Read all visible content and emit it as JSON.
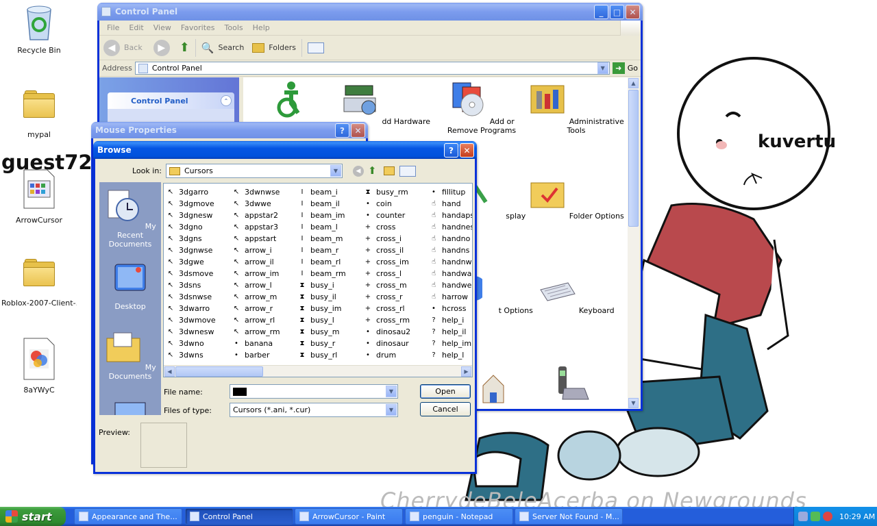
{
  "desktop": {
    "icons": [
      {
        "label": "Recycle Bin"
      },
      {
        "label": "mypal"
      },
      {
        "label": "ArrowCursor"
      },
      {
        "label": "Roblox-2007-Client-..."
      },
      {
        "label": "8aYWyC"
      }
    ],
    "overlay_text_left": "guest72",
    "overlay_text_right": "kuvertu",
    "watermark": "CherrydeBeleAcerba on Newgrounds"
  },
  "control_panel": {
    "title": "Control Panel",
    "menu": [
      "File",
      "Edit",
      "View",
      "Favorites",
      "Tools",
      "Help"
    ],
    "toolbar": {
      "back": "Back",
      "search": "Search",
      "folders": "Folders"
    },
    "address_label": "Address",
    "address_value": "Control Panel",
    "go_label": "Go",
    "task_pane_title": "Control Panel",
    "items": [
      {
        "label": "",
        "icon": "accessibility-icon"
      },
      {
        "label": "dd Hardware",
        "icon": "hardware-icon"
      },
      {
        "label": "Add or Remove Programs",
        "icon": "add-remove-programs-icon"
      },
      {
        "label": "Administrative Tools",
        "icon": "admin-tools-icon"
      },
      {
        "label": "splay",
        "icon": "display-icon"
      },
      {
        "label": "Folder Options",
        "icon": "folder-options-icon"
      },
      {
        "label": "t Options",
        "icon": "internet-options-icon"
      },
      {
        "label": "Keyboard",
        "icon": "keyboard-icon"
      }
    ]
  },
  "mouse_properties": {
    "title": "Mouse Properties"
  },
  "browse": {
    "title": "Browse",
    "look_in_label": "Look in:",
    "look_in_value": "Cursors",
    "places": [
      {
        "label": "My Recent Documents"
      },
      {
        "label": "Desktop"
      },
      {
        "label": "My Documents"
      }
    ],
    "columns": [
      [
        "3dgarro",
        "3dgmove",
        "3dgnesw",
        "3dgno",
        "3dgns",
        "3dgnwse",
        "3dgwe",
        "3dsmove",
        "3dsns",
        "3dsnwse",
        "3dwarro",
        "3dwmove",
        "3dwnesw",
        "3dwno",
        "3dwns"
      ],
      [
        "3dwnwse",
        "3dwwe",
        "appstar2",
        "appstar3",
        "appstart",
        "arrow_i",
        "arrow_il",
        "arrow_im",
        "arrow_l",
        "arrow_m",
        "arrow_r",
        "arrow_rl",
        "arrow_rm",
        "banana",
        "barber"
      ],
      [
        "beam_i",
        "beam_il",
        "beam_im",
        "beam_l",
        "beam_m",
        "beam_r",
        "beam_rl",
        "beam_rm",
        "busy_i",
        "busy_il",
        "busy_im",
        "busy_l",
        "busy_m",
        "busy_r",
        "busy_rl"
      ],
      [
        "busy_rm",
        "coin",
        "counter",
        "cross",
        "cross_i",
        "cross_il",
        "cross_im",
        "cross_l",
        "cross_m",
        "cross_r",
        "cross_rl",
        "cross_rm",
        "dinosau2",
        "dinosaur",
        "drum"
      ],
      [
        "fillitup",
        "hand",
        "handapst",
        "handnesw",
        "handno",
        "handns",
        "handnwse",
        "handwait",
        "handwe",
        "harrow",
        "hcross",
        "help_i",
        "help_il",
        "help_im",
        "help_l"
      ]
    ],
    "file_name_label": "File name:",
    "file_name_value": "",
    "files_of_type_label": "Files of type:",
    "files_of_type_value": "Cursors (*.ani, *.cur)",
    "open_label": "Open",
    "cancel_label": "Cancel",
    "preview_label": "Preview:"
  },
  "taskbar": {
    "start_label": "start",
    "tasks": [
      {
        "label": "Appearance and The..."
      },
      {
        "label": "Control Panel"
      },
      {
        "label": "ArrowCursor - Paint"
      },
      {
        "label": "penguin - Notepad"
      },
      {
        "label": "Server Not Found - M..."
      }
    ],
    "clock": "10:29 AM"
  },
  "colors": {
    "xp_blue": "#0052dc",
    "start_green": "#2f8a2f",
    "taskbar_blue": "#245edb"
  }
}
